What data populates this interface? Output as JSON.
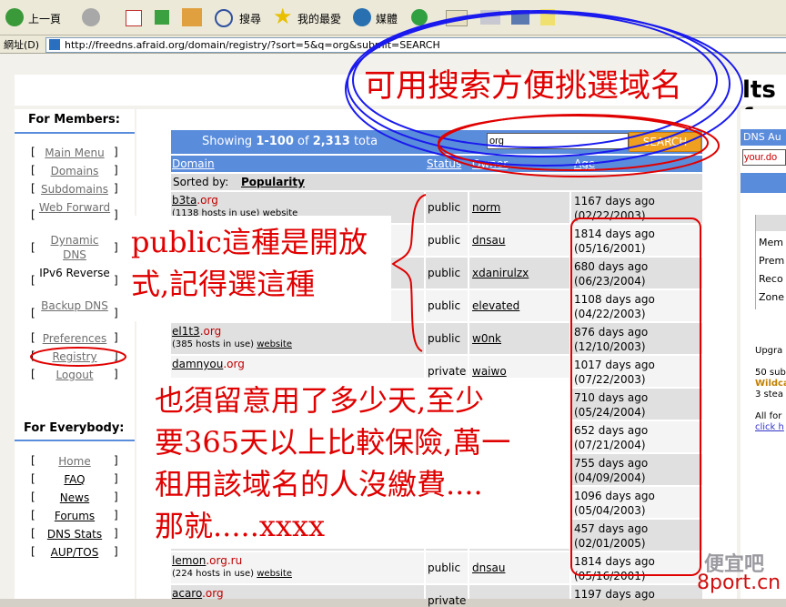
{
  "browser": {
    "back_label": "上一頁",
    "search_label": "搜尋",
    "favorites_label": "我的最愛",
    "media_label": "媒體",
    "address_label": "網址(D)",
    "url": "http://freedns.afraid.org/domain/registry/?sort=5&q=org&submit=SEARCH"
  },
  "banner": {
    "partial_title": "lts f"
  },
  "sidebar": {
    "members_heading": "For Members:",
    "member_links": [
      "Main Menu",
      "Domains",
      "Subdomains",
      "Web Forward",
      "Dynamic DNS",
      "IPv6 Reverse",
      "Backup DNS",
      "Preferences",
      "Registry",
      "Logout"
    ],
    "everybody_heading": "For Everybody:",
    "everybody_links": [
      "Home",
      "FAQ",
      "News",
      "Forums",
      "DNS Stats",
      "AUP/TOS"
    ]
  },
  "header": {
    "showing_prefix": "Showing ",
    "range": "1-100",
    "of_word": " of ",
    "total": "2,313",
    "total_suffix": " tota",
    "search_value": "org",
    "search_button": "SEARCH"
  },
  "columns": [
    "Domain",
    "Status",
    "Owner",
    "Age"
  ],
  "sorted": {
    "label": "Sorted by: ",
    "value": "Popularity"
  },
  "rows": [
    {
      "name": "b3ta",
      "tld": ".org",
      "hosts": "(1138 hosts in use)",
      "link": "website",
      "status": "public",
      "owner": "norm",
      "age": "1167 days ago",
      "date": "(02/22/2003)"
    },
    {
      "name": "",
      "tld": "",
      "hosts": "",
      "link": "",
      "status": "public",
      "owner": "dnsau",
      "age": "1814 days ago",
      "date": "(05/16/2001)"
    },
    {
      "name": "",
      "tld": "",
      "hosts": "",
      "link": "",
      "status": "public",
      "owner": "xdanirulzx",
      "age": "680 days ago",
      "date": "(06/23/2004)"
    },
    {
      "name": "",
      "tld": "",
      "hosts": "",
      "link": "",
      "status": "public",
      "owner": "elevated",
      "age": "1108 days ago",
      "date": "(04/22/2003)"
    },
    {
      "name": "el1t3",
      "tld": ".org",
      "hosts": "(385 hosts in use)",
      "link": "website",
      "status": "public",
      "owner": "w0nk",
      "age": "876 days ago",
      "date": "(12/10/2003)"
    },
    {
      "name": "damnyou",
      "tld": ".org",
      "hosts": "",
      "link": "",
      "status": "private",
      "owner": "waiwo",
      "age": "1017 days ago",
      "date": "(07/22/2003)"
    },
    {
      "name": "",
      "tld": "",
      "hosts": "",
      "link": "",
      "status": "",
      "owner": "",
      "age": "710 days ago",
      "date": "(05/24/2004)"
    },
    {
      "name": "",
      "tld": "",
      "hosts": "",
      "link": "",
      "status": "",
      "owner": "",
      "age": "652 days ago",
      "date": "(07/21/2004)"
    },
    {
      "name": "",
      "tld": "",
      "hosts": "",
      "link": "",
      "status": "",
      "owner": "",
      "age": "755 days ago",
      "date": "(04/09/2004)"
    },
    {
      "name": "",
      "tld": "",
      "hosts": "",
      "link": "",
      "status": "",
      "owner": "",
      "age": "1096 days ago",
      "date": "(05/04/2003)"
    },
    {
      "name": "",
      "tld": "",
      "hosts": "",
      "link": "",
      "status": "",
      "owner": "",
      "age": "457 days ago",
      "date": "(02/01/2005)"
    },
    {
      "name": "lemon",
      "tld": ".org.ru",
      "hosts": "(224 hosts in use)",
      "link": "website",
      "status": "public",
      "owner": "dnsau",
      "age": "1814 days ago",
      "date": "(05/16/2001)"
    },
    {
      "name": "acaro",
      "tld": ".org",
      "hosts": "",
      "link": "",
      "status": "private",
      "owner": "",
      "age": "1197 days ago",
      "date": ""
    }
  ],
  "right_panel": {
    "dns_label": "DNS Au",
    "input_placeholder": "your.do",
    "items": [
      "Mem",
      "Prem",
      "Reco",
      "Zone"
    ],
    "upgrade": "Upgra",
    "promo1": "50 sub",
    "promo2": "Wildca",
    "promo3": "3 stea",
    "allfor": "All for",
    "click": "click h"
  },
  "annotations": {
    "top": "可用搜索方便挑選域名",
    "public_note": "public這種是開放式,記得選這種",
    "age_note_1": "也須留意用了多少天,至少",
    "age_note_2": "要365天以上比較保險,萬一",
    "age_note_3": "租用該域名的人沒繳費....",
    "age_note_4": "那就.....xxxx"
  },
  "watermark": {
    "text": "便宜吧",
    "site": "8port.cn"
  },
  "colors": {
    "header_blue": "#5a8cdc",
    "search_orange": "#f0a020",
    "link_red": "#c00000",
    "annotation_red": "#e00000",
    "annotation_blue": "#1a1aee"
  }
}
